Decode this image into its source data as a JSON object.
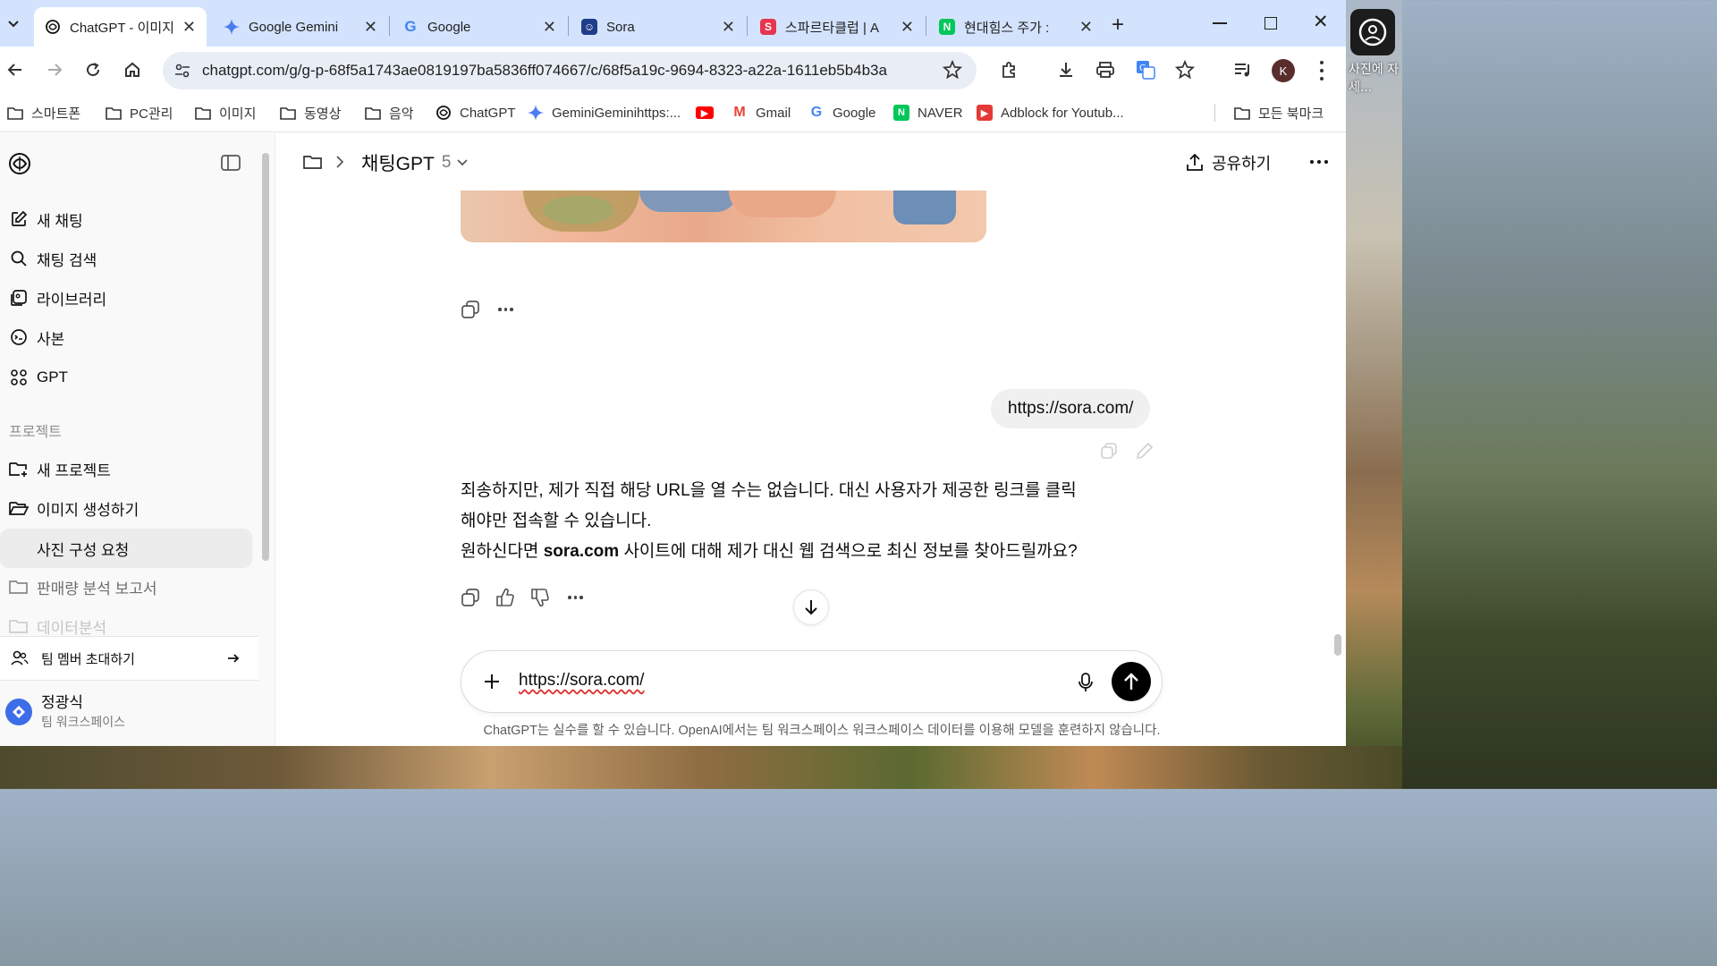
{
  "browser": {
    "tabs": [
      {
        "title": "ChatGPT - 이미지",
        "active": true
      },
      {
        "title": "Google Gemini"
      },
      {
        "title": "Google"
      },
      {
        "title": "Sora"
      },
      {
        "title": "스파르타클럽 | A"
      },
      {
        "title": "현대힘스 주가 : "
      }
    ],
    "url": "chatgpt.com/g/g-p-68f5a1743ae0819197ba5836ff074667/c/68f5a19c-9694-8323-a22a-1611eb5b4b3a",
    "profile_initial": "K",
    "bookmarks": [
      {
        "label": "스마트폰"
      },
      {
        "label": "PC관리"
      },
      {
        "label": "이미지"
      },
      {
        "label": "동영상"
      },
      {
        "label": "음악"
      },
      {
        "label": "ChatGPT"
      },
      {
        "label": "GeminiGeminihttps:..."
      },
      {
        "label": ""
      },
      {
        "label": "Gmail"
      },
      {
        "label": "Google"
      },
      {
        "label": "NAVER"
      },
      {
        "label": "Adblock for Youtub..."
      }
    ],
    "all_bookmarks": "모든 북마크"
  },
  "desktop": {
    "side_text": "사진에 자세..."
  },
  "sidebar": {
    "items": [
      {
        "label": "새 채팅"
      },
      {
        "label": "채팅 검색"
      },
      {
        "label": "라이브러리"
      },
      {
        "label": "사본"
      },
      {
        "label": "GPT"
      }
    ],
    "section_label": "프로젝트",
    "projects": [
      {
        "label": "새 프로젝트"
      },
      {
        "label": "이미지 생성하기"
      },
      {
        "label": "사진 구성 요청"
      },
      {
        "label": "판매량 분석 보고서"
      },
      {
        "label": "데이터분석"
      }
    ],
    "invite_label": "팀 멤버 초대하기",
    "user_name": "정광식",
    "workspace": "팀 워크스페이스"
  },
  "chat": {
    "model_label": "채팅GPT",
    "model_version": "5",
    "share_label": "공유하기",
    "user_message": "https://sora.com/",
    "answer_line1": "죄송하지만, 제가 직접 해당 URL을 열 수는 없습니다. 대신 사용자가 제공한 링크를 클릭",
    "answer_line2": "해야만 접속할 수 있습니다.",
    "answer_line3_pre": "원하신다면 ",
    "answer_line3_bold": "sora.com",
    "answer_line3_post": " 사이트에 대해 제가 대신 웹 검색으로 최신 정보를 찾아드릴까요?",
    "composer_text": "https://sora.com/",
    "footer_note": "ChatGPT는 실수를 할 수 있습니다. OpenAI에서는 팀 워크스페이스 워크스페이스 데이터를 이용해 모델을 훈련하지 않습니다."
  },
  "colors": {
    "tabstrip": "#d3e3fd",
    "omnibox": "#e9eef6",
    "sidebar_bg": "#f9f9f9",
    "user_bubble": "#f0f0f0",
    "send_button": "#000000",
    "avatar": "#3d6ee8"
  }
}
